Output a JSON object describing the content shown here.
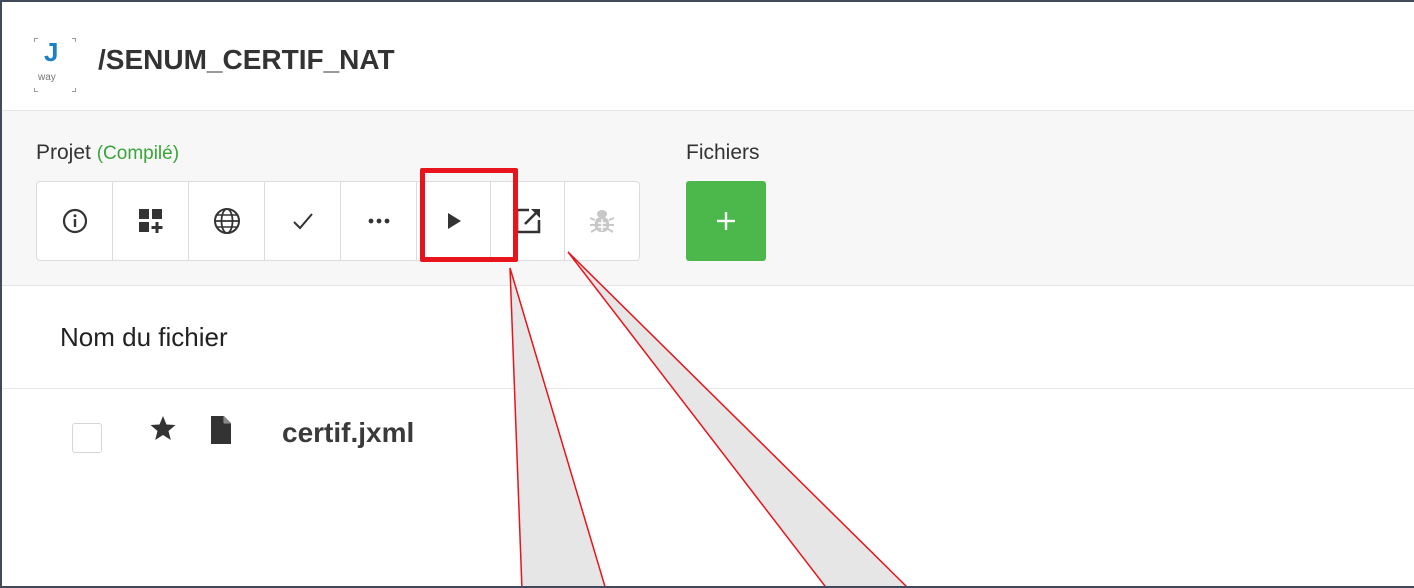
{
  "app": {
    "logo_letter": "J",
    "logo_sub": "way",
    "title": "/SENUM_CERTIF_NAT"
  },
  "toolbar": {
    "project_label": "Projet",
    "project_status": "(Compilé)",
    "files_label": "Fichiers",
    "buttons": [
      {
        "name": "info",
        "icon": "info-circle-icon"
      },
      {
        "name": "add-module",
        "icon": "grid-plus-icon"
      },
      {
        "name": "web",
        "icon": "globe-icon"
      },
      {
        "name": "validate",
        "icon": "check-icon"
      },
      {
        "name": "more",
        "icon": "ellipsis-icon"
      },
      {
        "name": "run",
        "icon": "play-icon"
      },
      {
        "name": "open-external",
        "icon": "external-link-icon"
      },
      {
        "name": "debug",
        "icon": "bug-icon",
        "disabled": true
      }
    ],
    "add_file_icon": "plus-icon"
  },
  "file_list": {
    "column_header": "Nom du fichier",
    "rows": [
      {
        "name": "certif.jxml",
        "starred": true,
        "checked": false
      }
    ]
  },
  "colors": {
    "accent_green": "#4cb84c",
    "status_green": "#3aa53a",
    "logo_blue": "#1e7fc9",
    "annotation_red": "#e8141c",
    "callout_fill": "#e6e6e6"
  }
}
